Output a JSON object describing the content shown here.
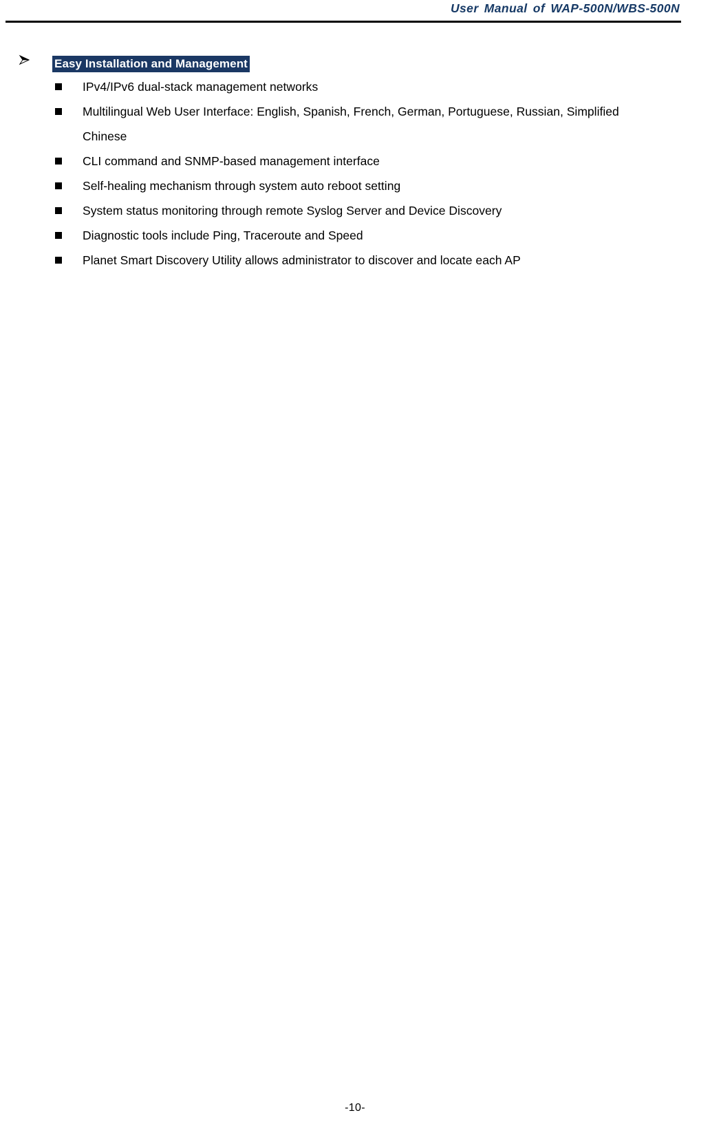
{
  "header": {
    "title": "User  Manual  of  WAP-500N/WBS-500N",
    "title_color": "#173a66",
    "rule_color": "#000000"
  },
  "section": {
    "arrow_icon": "arrow-bullet-icon",
    "heading": "Easy Installation and Management",
    "heading_bg_color": "#1b3864",
    "heading_text_color": "#ffffff",
    "bullets": [
      {
        "text": "IPv4/IPv6 dual-stack management networks"
      },
      {
        "text": "Multilingual Web User Interface: English, Spanish, French, German, Portuguese, Russian, Simplified Chinese"
      },
      {
        "text": "CLI command and SNMP-based management interface"
      },
      {
        "text": "Self-healing mechanism through system auto reboot setting"
      },
      {
        "text": "System status monitoring through remote Syslog Server and Device Discovery"
      },
      {
        "text": "Diagnostic tools include Ping, Traceroute and Speed"
      },
      {
        "text": "Planet Smart Discovery Utility allows administrator to discover and locate each AP"
      }
    ]
  },
  "footer": {
    "page_number": "-10-"
  }
}
